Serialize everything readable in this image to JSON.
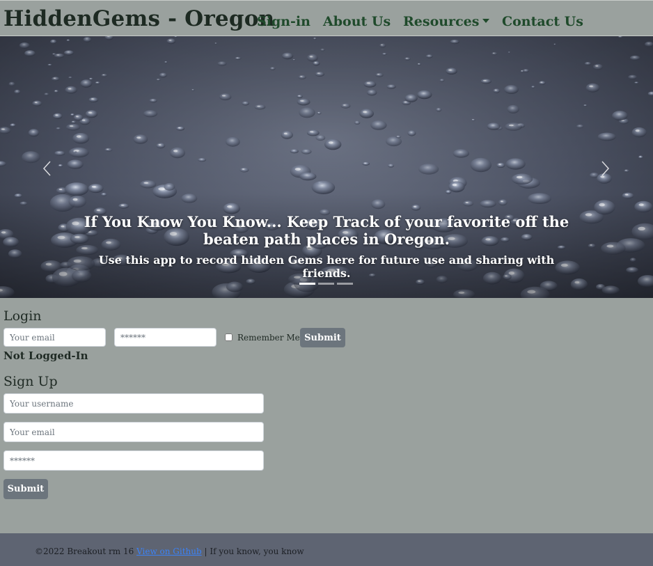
{
  "navbar": {
    "brand": "HiddenGems - Oregon",
    "links": [
      "Sign-in",
      "About Us",
      "Resources",
      "Contact Us"
    ]
  },
  "carousel": {
    "title": "If You Know You Know... Keep Track of your favorite off the beaten path places in Oregon.",
    "subtitle": "Use this app to record hidden Gems here for future use and sharing with friends.",
    "slide_count": 3,
    "active_slide": 1
  },
  "login": {
    "title": "Login",
    "email_placeholder": "Your email",
    "password_placeholder": "******",
    "remember_label": "Remember Me",
    "submit_label": "Submit",
    "status": "Not Logged-In"
  },
  "signup": {
    "title": "Sign Up",
    "username_placeholder": "Your username",
    "email_placeholder": "Your email",
    "password_placeholder": "******",
    "submit_label": "Submit"
  },
  "footer": {
    "copyright": "©2022 Breakout rm 16",
    "github_link": "View on Github",
    "tagline": "| If you know, you know"
  },
  "colors": {
    "page_bg": "#9aa19e",
    "nav_link": "#1f4a2b",
    "button": "#6c757d",
    "footer_bg": "#5e6472"
  }
}
